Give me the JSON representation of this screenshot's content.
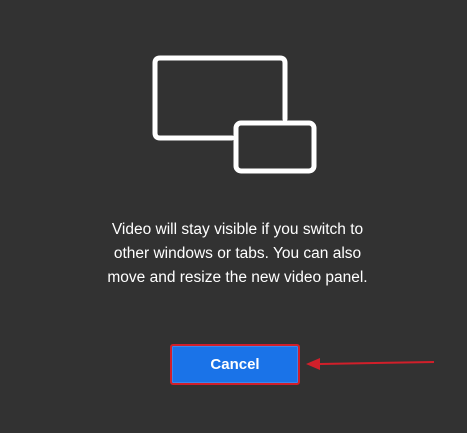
{
  "illustration": {
    "icon": "picture-in-picture-icon"
  },
  "message": {
    "text": "Video will stay visible if you switch to other windows or tabs. You can also move and resize the new video panel."
  },
  "actions": {
    "cancel_label": "Cancel"
  },
  "colors": {
    "background": "#323232",
    "button": "#1a73e8",
    "highlight": "#d11f2a",
    "icon_stroke": "#ffffff"
  },
  "annotation": {
    "icon": "arrow-left-icon",
    "color": "#d11f2a"
  }
}
